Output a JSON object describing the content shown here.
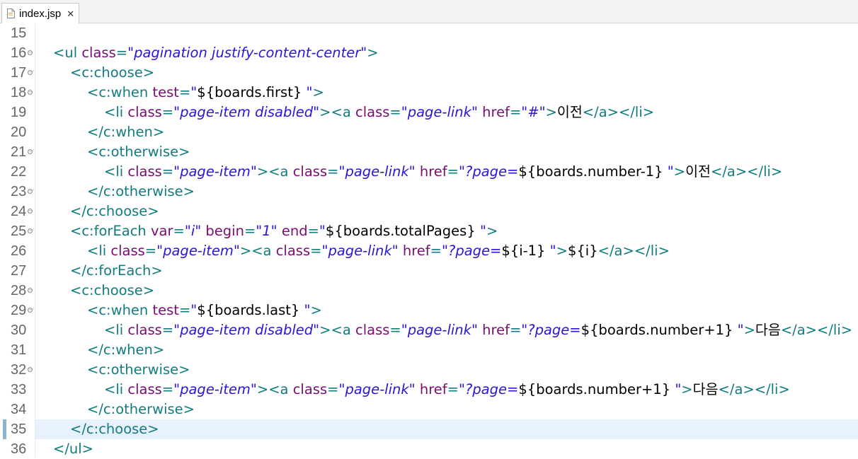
{
  "tab": {
    "label": "index.jsp",
    "close": "✕",
    "icon": "jsp-file-icon"
  },
  "colors": {
    "tag": "#117c80",
    "attr": "#7a0c73",
    "value": "#2a16d8",
    "text": "#000000",
    "current_line": "#e8f2fe"
  },
  "lines": [
    {
      "num": "15",
      "fold": false,
      "indent": 0,
      "tokens": []
    },
    {
      "num": "16",
      "fold": true,
      "indent": 0,
      "tokens": [
        {
          "t": "tag",
          "v": "<ul "
        },
        {
          "t": "attr",
          "v": "class"
        },
        {
          "t": "tag",
          "v": "="
        },
        {
          "t": "val",
          "v": "\"pagination justify-content-center\""
        },
        {
          "t": "tag",
          "v": ">"
        }
      ]
    },
    {
      "num": "17",
      "fold": true,
      "indent": 1,
      "tokens": [
        {
          "t": "tag",
          "v": "<c:choose>"
        }
      ]
    },
    {
      "num": "18",
      "fold": true,
      "indent": 2,
      "tokens": [
        {
          "t": "tag",
          "v": "<c:when "
        },
        {
          "t": "attr",
          "v": "test"
        },
        {
          "t": "tag",
          "v": "="
        },
        {
          "t": "val",
          "v": "\""
        },
        {
          "t": "txt",
          "v": "${boards.first} "
        },
        {
          "t": "val",
          "v": "\""
        },
        {
          "t": "tag",
          "v": ">"
        }
      ]
    },
    {
      "num": "19",
      "fold": false,
      "indent": 3,
      "tokens": [
        {
          "t": "tag",
          "v": "<li "
        },
        {
          "t": "attr",
          "v": "class"
        },
        {
          "t": "tag",
          "v": "="
        },
        {
          "t": "val",
          "v": "\"page-item disabled\""
        },
        {
          "t": "tag",
          "v": "><a "
        },
        {
          "t": "attr",
          "v": "class"
        },
        {
          "t": "tag",
          "v": "="
        },
        {
          "t": "val",
          "v": "\"page-link\" "
        },
        {
          "t": "attr",
          "v": "href"
        },
        {
          "t": "tag",
          "v": "="
        },
        {
          "t": "val",
          "v": "\"#\""
        },
        {
          "t": "tag",
          "v": ">"
        },
        {
          "t": "txt",
          "v": "이전"
        },
        {
          "t": "tag",
          "v": "</a></li>"
        }
      ]
    },
    {
      "num": "20",
      "fold": false,
      "indent": 2,
      "tokens": [
        {
          "t": "tag",
          "v": "</c:when>"
        }
      ]
    },
    {
      "num": "21",
      "fold": true,
      "indent": 2,
      "tokens": [
        {
          "t": "tag",
          "v": "<c:otherwise>"
        }
      ]
    },
    {
      "num": "22",
      "fold": false,
      "indent": 3,
      "tokens": [
        {
          "t": "tag",
          "v": "<li "
        },
        {
          "t": "attr",
          "v": "class"
        },
        {
          "t": "tag",
          "v": "="
        },
        {
          "t": "val",
          "v": "\"page-item\""
        },
        {
          "t": "tag",
          "v": "><a "
        },
        {
          "t": "attr",
          "v": "class"
        },
        {
          "t": "tag",
          "v": "="
        },
        {
          "t": "val",
          "v": "\"page-link\" "
        },
        {
          "t": "attr",
          "v": "href"
        },
        {
          "t": "tag",
          "v": "="
        },
        {
          "t": "val",
          "v": "\"?page="
        },
        {
          "t": "txt",
          "v": "${boards.number-1} "
        },
        {
          "t": "val",
          "v": "\""
        },
        {
          "t": "tag",
          "v": ">"
        },
        {
          "t": "txt",
          "v": "이전"
        },
        {
          "t": "tag",
          "v": "</a></li>"
        }
      ]
    },
    {
      "num": "23",
      "fold": true,
      "indent": 2,
      "tokens": [
        {
          "t": "tag",
          "v": "</c:otherwise>"
        }
      ]
    },
    {
      "num": "24",
      "fold": true,
      "indent": 1,
      "tokens": [
        {
          "t": "tag",
          "v": "</c:choose>"
        }
      ]
    },
    {
      "num": "25",
      "fold": true,
      "indent": 1,
      "tokens": [
        {
          "t": "tag",
          "v": "<c:forEach "
        },
        {
          "t": "attr",
          "v": "var"
        },
        {
          "t": "tag",
          "v": "="
        },
        {
          "t": "val",
          "v": "\"i\" "
        },
        {
          "t": "attr",
          "v": "begin"
        },
        {
          "t": "tag",
          "v": "="
        },
        {
          "t": "val",
          "v": "\"1\" "
        },
        {
          "t": "attr",
          "v": "end"
        },
        {
          "t": "tag",
          "v": "="
        },
        {
          "t": "val",
          "v": "\""
        },
        {
          "t": "txt",
          "v": "${boards.totalPages} "
        },
        {
          "t": "val",
          "v": "\""
        },
        {
          "t": "tag",
          "v": ">"
        }
      ]
    },
    {
      "num": "26",
      "fold": false,
      "indent": 2,
      "tokens": [
        {
          "t": "tag",
          "v": "<li "
        },
        {
          "t": "attr",
          "v": "class"
        },
        {
          "t": "tag",
          "v": "="
        },
        {
          "t": "val",
          "v": "\"page-item\""
        },
        {
          "t": "tag",
          "v": "><a "
        },
        {
          "t": "attr",
          "v": "class"
        },
        {
          "t": "tag",
          "v": "="
        },
        {
          "t": "val",
          "v": "\"page-link\" "
        },
        {
          "t": "attr",
          "v": "href"
        },
        {
          "t": "tag",
          "v": "="
        },
        {
          "t": "val",
          "v": "\"?page="
        },
        {
          "t": "txt",
          "v": "${i-1} "
        },
        {
          "t": "val",
          "v": "\""
        },
        {
          "t": "tag",
          "v": ">"
        },
        {
          "t": "txt",
          "v": "${i}"
        },
        {
          "t": "tag",
          "v": "</a></li>"
        }
      ]
    },
    {
      "num": "27",
      "fold": false,
      "indent": 1,
      "tokens": [
        {
          "t": "tag",
          "v": "</c:forEach>"
        }
      ]
    },
    {
      "num": "28",
      "fold": true,
      "indent": 1,
      "tokens": [
        {
          "t": "tag",
          "v": "<c:choose>"
        }
      ]
    },
    {
      "num": "29",
      "fold": true,
      "indent": 2,
      "tokens": [
        {
          "t": "tag",
          "v": "<c:when "
        },
        {
          "t": "attr",
          "v": "test"
        },
        {
          "t": "tag",
          "v": "="
        },
        {
          "t": "val",
          "v": "\""
        },
        {
          "t": "txt",
          "v": "${boards.last} "
        },
        {
          "t": "val",
          "v": "\""
        },
        {
          "t": "tag",
          "v": ">"
        }
      ]
    },
    {
      "num": "30",
      "fold": false,
      "indent": 3,
      "tokens": [
        {
          "t": "tag",
          "v": "<li "
        },
        {
          "t": "attr",
          "v": "class"
        },
        {
          "t": "tag",
          "v": "="
        },
        {
          "t": "val",
          "v": "\"page-item disabled\""
        },
        {
          "t": "tag",
          "v": "><a "
        },
        {
          "t": "attr",
          "v": "class"
        },
        {
          "t": "tag",
          "v": "="
        },
        {
          "t": "val",
          "v": "\"page-link\" "
        },
        {
          "t": "attr",
          "v": "href"
        },
        {
          "t": "tag",
          "v": "="
        },
        {
          "t": "val",
          "v": "\"?page="
        },
        {
          "t": "txt",
          "v": "${boards.number+1} "
        },
        {
          "t": "val",
          "v": "\""
        },
        {
          "t": "tag",
          "v": ">"
        },
        {
          "t": "txt",
          "v": "다음"
        },
        {
          "t": "tag",
          "v": "</a></li>"
        }
      ]
    },
    {
      "num": "31",
      "fold": false,
      "indent": 2,
      "tokens": [
        {
          "t": "tag",
          "v": "</c:when>"
        }
      ]
    },
    {
      "num": "32",
      "fold": true,
      "indent": 2,
      "tokens": [
        {
          "t": "tag",
          "v": "<c:otherwise>"
        }
      ]
    },
    {
      "num": "33",
      "fold": false,
      "indent": 3,
      "tokens": [
        {
          "t": "tag",
          "v": "<li "
        },
        {
          "t": "attr",
          "v": "class"
        },
        {
          "t": "tag",
          "v": "="
        },
        {
          "t": "val",
          "v": "\"page-item\""
        },
        {
          "t": "tag",
          "v": "><a "
        },
        {
          "t": "attr",
          "v": "class"
        },
        {
          "t": "tag",
          "v": "="
        },
        {
          "t": "val",
          "v": "\"page-link\" "
        },
        {
          "t": "attr",
          "v": "href"
        },
        {
          "t": "tag",
          "v": "="
        },
        {
          "t": "val",
          "v": "\"?page="
        },
        {
          "t": "txt",
          "v": "${boards.number+1} "
        },
        {
          "t": "val",
          "v": "\""
        },
        {
          "t": "tag",
          "v": ">"
        },
        {
          "t": "txt",
          "v": "다음"
        },
        {
          "t": "tag",
          "v": "</a></li>"
        }
      ]
    },
    {
      "num": "34",
      "fold": false,
      "indent": 2,
      "tokens": [
        {
          "t": "tag",
          "v": "</c:otherwise>"
        }
      ]
    },
    {
      "num": "35",
      "fold": false,
      "indent": 1,
      "current": true,
      "tokens": [
        {
          "t": "tag",
          "v": "</c:choose>"
        }
      ]
    },
    {
      "num": "36",
      "fold": false,
      "indent": 0,
      "tokens": [
        {
          "t": "tag",
          "v": "</ul>"
        }
      ]
    }
  ]
}
